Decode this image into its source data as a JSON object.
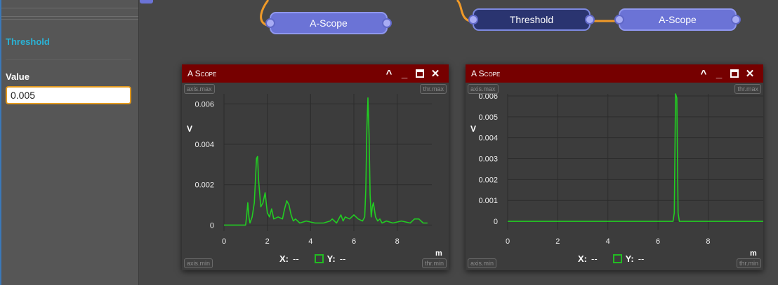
{
  "sidebar": {
    "section_title": "Threshold",
    "field_label": "Value",
    "field_value": "0.005"
  },
  "nodes": [
    {
      "label": "A-Scope"
    },
    {
      "label": "Threshold"
    },
    {
      "label": "A-Scope"
    }
  ],
  "colors": {
    "accent_orange": "#e39a1f",
    "node_scope": "#6b73d6",
    "node_threshold": "#2a3470",
    "titlebar": "#760000",
    "trace": "#22cc22"
  },
  "icons": [
    "collapse-icon",
    "minimize-icon",
    "maximize-icon",
    "close-icon"
  ],
  "scopes": [
    {
      "title": "A Scope",
      "badge_axis_max": "axis.max",
      "badge_axis_min": "axis.min",
      "badge_thr_max": "thr.max",
      "badge_thr_min": "thr.min",
      "ylabel": "V",
      "xlabel": "m",
      "x_label": "X:",
      "x_value": "--",
      "y_label": "Y:",
      "y_value": "--"
    },
    {
      "title": "A Scope",
      "badge_axis_max": "axis.max",
      "badge_axis_min": "axis.min",
      "badge_thr_max": "thr.max",
      "badge_thr_min": "thr.min",
      "ylabel": "V",
      "xlabel": "m",
      "x_label": "X:",
      "x_value": "--",
      "y_label": "Y:",
      "y_value": "--"
    }
  ],
  "chart_data": [
    {
      "type": "line",
      "xlim": [
        0,
        9.6
      ],
      "ylim": [
        -0.0003,
        0.0065
      ],
      "x_ticks": [
        "0",
        "2",
        "4",
        "6",
        "8"
      ],
      "y_ticks": [
        "0",
        "0.002",
        "0.004",
        "0.006"
      ],
      "series": [
        {
          "x": [
            0,
            0.9,
            1.0,
            1.05,
            1.1,
            1.15,
            1.2,
            1.3,
            1.4,
            1.5,
            1.55,
            1.6,
            1.7,
            1.8,
            1.9,
            2.0,
            2.1,
            2.2,
            2.3,
            2.5,
            2.7,
            2.8,
            2.9,
            3.0,
            3.1,
            3.2,
            3.3,
            3.5,
            3.8,
            4.2,
            4.6,
            4.9,
            5.0,
            5.2,
            5.4,
            5.5,
            5.6,
            5.8,
            6.0,
            6.2,
            6.4,
            6.5,
            6.55,
            6.6,
            6.65,
            6.7,
            6.75,
            6.8,
            6.85,
            6.9,
            7.0,
            7.1,
            7.2,
            7.3,
            7.5,
            7.8,
            8.2,
            8.6,
            8.8,
            9.0,
            9.2,
            9.4
          ],
          "y": [
            0,
            0,
            0,
            0.0005,
            0.0011,
            0.0004,
            0.0001,
            0.0004,
            0.0011,
            0.0033,
            0.0034,
            0.0022,
            0.0009,
            0.0011,
            0.0016,
            0.0006,
            0.0004,
            0.0008,
            0.0003,
            0.0004,
            0.0003,
            0.0008,
            0.0012,
            0.001,
            0.0005,
            0.0002,
            0.0003,
            0.0001,
            0.0002,
            0.0001,
            0.0001,
            0.0002,
            0.0003,
            0.0001,
            0.0005,
            0.0002,
            0.0004,
            0.0003,
            0.0005,
            0.0003,
            0.0002,
            0.0004,
            0.0018,
            0.0048,
            0.0063,
            0.0045,
            0.0015,
            0.0004,
            0.0009,
            0.0011,
            0.0004,
            0.0002,
            0.0003,
            0.0001,
            0.0002,
            0.0001,
            0.0002,
            0.0001,
            0.0003,
            0.0003,
            0.0001,
            0.0001
          ]
        }
      ]
    },
    {
      "type": "line",
      "xlim": [
        0,
        10.2
      ],
      "ylim": [
        -0.0004,
        0.0061
      ],
      "x_ticks": [
        "0",
        "2",
        "4",
        "6",
        "8"
      ],
      "y_ticks": [
        "0",
        "0.001",
        "0.002",
        "0.003",
        "0.004",
        "0.005",
        "0.006"
      ],
      "series": [
        {
          "x": [
            0,
            6.55,
            6.6,
            6.65,
            6.7,
            6.75,
            6.8,
            6.85,
            6.9,
            10.2
          ],
          "y": [
            0,
            0,
            0,
            0.0004,
            0.0061,
            0.0059,
            0.0004,
            0,
            0,
            0
          ]
        }
      ]
    }
  ]
}
